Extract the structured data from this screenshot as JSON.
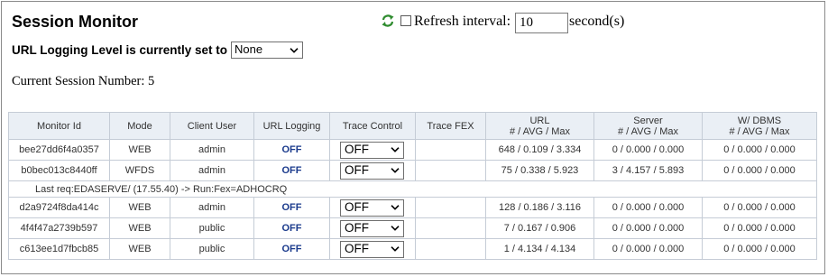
{
  "page": {
    "title": "Session Monitor",
    "refresh_label": "Refresh interval:",
    "refresh_value": "10",
    "refresh_unit": "second(s)",
    "logging_label": "URL Logging Level is currently set to",
    "logging_value": "None",
    "session_count_label": "Current Session Number: 5"
  },
  "table": {
    "headers": {
      "monitor_id": "Monitor Id",
      "mode": "Mode",
      "client_user": "Client User",
      "url_logging": "URL Logging",
      "trace_control": "Trace Control",
      "trace_fex": "Trace FEX",
      "url_line1": "URL",
      "url_line2": "# / AVG / Max",
      "server_line1": "Server",
      "server_line2": "# / AVG / Max",
      "dbms_line1": "W/ DBMS",
      "dbms_line2": "# / AVG / Max"
    },
    "rows": [
      {
        "id": "bee27dd6f4a0357",
        "mode": "WEB",
        "user": "admin",
        "logging": "OFF",
        "trace": "OFF",
        "fex": "",
        "url": "648 / 0.109 / 3.334",
        "server": "0 / 0.000 / 0.000",
        "dbms": "0 / 0.000 / 0.000"
      },
      {
        "id": "b0bec013c8440ff",
        "mode": "WFDS",
        "user": "admin",
        "logging": "OFF",
        "trace": "OFF",
        "fex": "",
        "url": "75 / 0.338 / 5.923",
        "server": "3 / 4.157 / 5.893",
        "dbms": "0 / 0.000 / 0.000"
      },
      {
        "id": "d2a9724f8da414c",
        "mode": "WEB",
        "user": "admin",
        "logging": "OFF",
        "trace": "OFF",
        "fex": "",
        "url": "128 / 0.186 / 3.116",
        "server": "0 / 0.000 / 0.000",
        "dbms": "0 / 0.000 / 0.000"
      },
      {
        "id": "4f4f47a2739b597",
        "mode": "WEB",
        "user": "public",
        "logging": "OFF",
        "trace": "OFF",
        "fex": "",
        "url": "7 / 0.167 / 0.906",
        "server": "0 / 0.000 / 0.000",
        "dbms": "0 / 0.000 / 0.000"
      },
      {
        "id": "c613ee1d7fbcb85",
        "mode": "WEB",
        "user": "public",
        "logging": "OFF",
        "trace": "OFF",
        "fex": "",
        "url": "1 / 4.134 / 4.134",
        "server": "0 / 0.000 / 0.000",
        "dbms": "0 / 0.000 / 0.000"
      }
    ],
    "note": "Last req:EDASERVE/ (17.55.40) -> Run:Fex=ADHOCRQ"
  },
  "icons": {
    "refresh": "refresh-icon",
    "dropdown": "chevron-down-icon"
  },
  "colors": {
    "header_bg": "#eaeff5",
    "border": "#c5ccd6",
    "off_text": "#1a3a8c",
    "refresh_icon": "#2e8b2e"
  }
}
